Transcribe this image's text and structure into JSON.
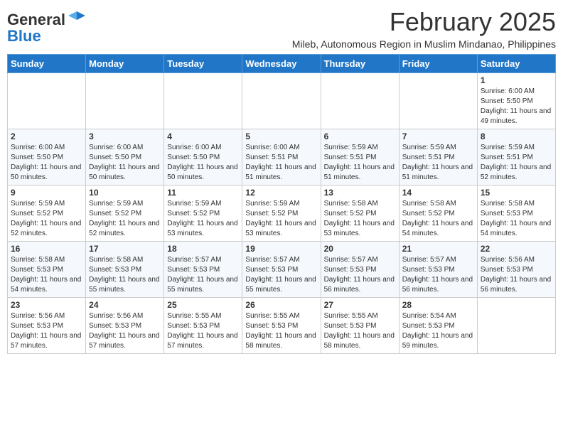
{
  "logo": {
    "general": "General",
    "blue": "Blue"
  },
  "title": "February 2025",
  "subtitle": "Mileb, Autonomous Region in Muslim Mindanao, Philippines",
  "days_of_week": [
    "Sunday",
    "Monday",
    "Tuesday",
    "Wednesday",
    "Thursday",
    "Friday",
    "Saturday"
  ],
  "weeks": [
    [
      {
        "day": "",
        "sunrise": "",
        "sunset": "",
        "daylight": ""
      },
      {
        "day": "",
        "sunrise": "",
        "sunset": "",
        "daylight": ""
      },
      {
        "day": "",
        "sunrise": "",
        "sunset": "",
        "daylight": ""
      },
      {
        "day": "",
        "sunrise": "",
        "sunset": "",
        "daylight": ""
      },
      {
        "day": "",
        "sunrise": "",
        "sunset": "",
        "daylight": ""
      },
      {
        "day": "",
        "sunrise": "",
        "sunset": "",
        "daylight": ""
      },
      {
        "day": "1",
        "sunrise": "6:00 AM",
        "sunset": "5:50 PM",
        "daylight": "11 hours and 49 minutes."
      }
    ],
    [
      {
        "day": "2",
        "sunrise": "6:00 AM",
        "sunset": "5:50 PM",
        "daylight": "11 hours and 50 minutes."
      },
      {
        "day": "3",
        "sunrise": "6:00 AM",
        "sunset": "5:50 PM",
        "daylight": "11 hours and 50 minutes."
      },
      {
        "day": "4",
        "sunrise": "6:00 AM",
        "sunset": "5:50 PM",
        "daylight": "11 hours and 50 minutes."
      },
      {
        "day": "5",
        "sunrise": "6:00 AM",
        "sunset": "5:51 PM",
        "daylight": "11 hours and 51 minutes."
      },
      {
        "day": "6",
        "sunrise": "5:59 AM",
        "sunset": "5:51 PM",
        "daylight": "11 hours and 51 minutes."
      },
      {
        "day": "7",
        "sunrise": "5:59 AM",
        "sunset": "5:51 PM",
        "daylight": "11 hours and 51 minutes."
      },
      {
        "day": "8",
        "sunrise": "5:59 AM",
        "sunset": "5:51 PM",
        "daylight": "11 hours and 52 minutes."
      }
    ],
    [
      {
        "day": "9",
        "sunrise": "5:59 AM",
        "sunset": "5:52 PM",
        "daylight": "11 hours and 52 minutes."
      },
      {
        "day": "10",
        "sunrise": "5:59 AM",
        "sunset": "5:52 PM",
        "daylight": "11 hours and 52 minutes."
      },
      {
        "day": "11",
        "sunrise": "5:59 AM",
        "sunset": "5:52 PM",
        "daylight": "11 hours and 53 minutes."
      },
      {
        "day": "12",
        "sunrise": "5:59 AM",
        "sunset": "5:52 PM",
        "daylight": "11 hours and 53 minutes."
      },
      {
        "day": "13",
        "sunrise": "5:58 AM",
        "sunset": "5:52 PM",
        "daylight": "11 hours and 53 minutes."
      },
      {
        "day": "14",
        "sunrise": "5:58 AM",
        "sunset": "5:52 PM",
        "daylight": "11 hours and 54 minutes."
      },
      {
        "day": "15",
        "sunrise": "5:58 AM",
        "sunset": "5:53 PM",
        "daylight": "11 hours and 54 minutes."
      }
    ],
    [
      {
        "day": "16",
        "sunrise": "5:58 AM",
        "sunset": "5:53 PM",
        "daylight": "11 hours and 54 minutes."
      },
      {
        "day": "17",
        "sunrise": "5:58 AM",
        "sunset": "5:53 PM",
        "daylight": "11 hours and 55 minutes."
      },
      {
        "day": "18",
        "sunrise": "5:57 AM",
        "sunset": "5:53 PM",
        "daylight": "11 hours and 55 minutes."
      },
      {
        "day": "19",
        "sunrise": "5:57 AM",
        "sunset": "5:53 PM",
        "daylight": "11 hours and 55 minutes."
      },
      {
        "day": "20",
        "sunrise": "5:57 AM",
        "sunset": "5:53 PM",
        "daylight": "11 hours and 56 minutes."
      },
      {
        "day": "21",
        "sunrise": "5:57 AM",
        "sunset": "5:53 PM",
        "daylight": "11 hours and 56 minutes."
      },
      {
        "day": "22",
        "sunrise": "5:56 AM",
        "sunset": "5:53 PM",
        "daylight": "11 hours and 56 minutes."
      }
    ],
    [
      {
        "day": "23",
        "sunrise": "5:56 AM",
        "sunset": "5:53 PM",
        "daylight": "11 hours and 57 minutes."
      },
      {
        "day": "24",
        "sunrise": "5:56 AM",
        "sunset": "5:53 PM",
        "daylight": "11 hours and 57 minutes."
      },
      {
        "day": "25",
        "sunrise": "5:55 AM",
        "sunset": "5:53 PM",
        "daylight": "11 hours and 57 minutes."
      },
      {
        "day": "26",
        "sunrise": "5:55 AM",
        "sunset": "5:53 PM",
        "daylight": "11 hours and 58 minutes."
      },
      {
        "day": "27",
        "sunrise": "5:55 AM",
        "sunset": "5:53 PM",
        "daylight": "11 hours and 58 minutes."
      },
      {
        "day": "28",
        "sunrise": "5:54 AM",
        "sunset": "5:53 PM",
        "daylight": "11 hours and 59 minutes."
      },
      {
        "day": "",
        "sunrise": "",
        "sunset": "",
        "daylight": ""
      }
    ]
  ]
}
